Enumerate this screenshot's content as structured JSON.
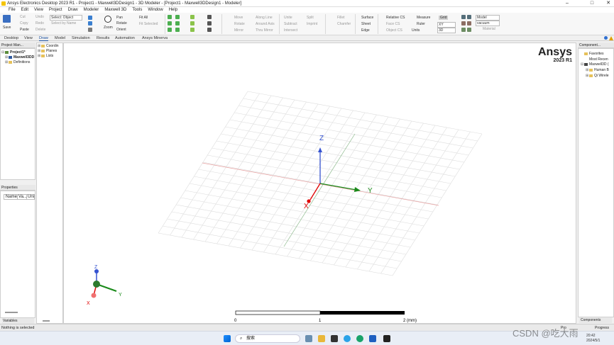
{
  "window": {
    "title": "Ansys Electronics Desktop 2023 R1 - Project1 - Maxwell3DDesign1 - 3D Modeler - [Project1 - Maxwell3DDesign1 - Modeler]",
    "controls": [
      "–",
      "□",
      "✕"
    ]
  },
  "menubar": {
    "items": [
      "File",
      "Edit",
      "View",
      "Project",
      "Draw",
      "Modeler",
      "Maxwell 3D",
      "Tools",
      "Window",
      "Help"
    ]
  },
  "ribbon": {
    "save": "Save",
    "cut": "Cut",
    "copy": "Copy",
    "paste": "Paste",
    "undo": "Undo",
    "redo": "Redo",
    "delete": "Delete",
    "select_value": "Select: Object",
    "select_by_name": "Select by Name",
    "pan": "Pan",
    "rotate": "Rotate",
    "orient": "Orient",
    "zoom": "Zoom",
    "fit_all": "Fit All",
    "fit_selected": "Fit Selected",
    "move": "Move",
    "rotate2": "Rotate",
    "mirror": "Mirror",
    "along_line": "Along Line",
    "around_axis": "Around Axis",
    "thru_mirror": "Thru Mirror",
    "unite": "Unite",
    "subtract": "Subtract",
    "intersect": "Intersect",
    "split": "Split",
    "imprint": "Imprint",
    "fillet": "Fillet",
    "chamfer": "Chamfer",
    "surface": "Surface",
    "sheet": "Sheet",
    "edge": "Edge",
    "relative_cs": "Relative CS",
    "face_cs": "Face CS",
    "object_cs": "Object CS",
    "measure": "Measure",
    "ruler": "Ruler",
    "units": "Units",
    "grid": "Grid",
    "plane_value": "XY",
    "dim_value": "3D",
    "model_value": "Model",
    "material_value": "vacuum",
    "material": "Material"
  },
  "tabs": [
    "Desktop",
    "View",
    "Draw",
    "Model",
    "Simulation",
    "Results",
    "Automation",
    "Ansys Minerva"
  ],
  "active_tab": "Draw",
  "project_manager": {
    "header": "Project Man...",
    "items": [
      {
        "label": "Project1*",
        "level": 0
      },
      {
        "label": "Maxwell3DD",
        "level": 1
      },
      {
        "label": "Definitions",
        "level": 1
      }
    ]
  },
  "model_tree": {
    "items": [
      "Coordin",
      "Planes",
      "Lists"
    ]
  },
  "properties": {
    "header": "Properties",
    "columns": [
      "Name",
      "Va...",
      "Uni"
    ]
  },
  "variables_tab": "Variables",
  "components": {
    "header": "Component...",
    "items": [
      "Favorites",
      "Most Recen",
      "Maxwell3D (",
      "Human B",
      "Qi Wirele"
    ],
    "footer_tab": "Components"
  },
  "viewport": {
    "brand": "Ansys",
    "version": "2023 R1",
    "axis_labels": [
      "Z",
      "Y",
      "X"
    ],
    "triad_labels": [
      "Z",
      "Y",
      "X"
    ],
    "scale_labels": [
      "0",
      "1",
      "2 (mm)"
    ]
  },
  "status": {
    "text": "Nothing is selected",
    "right_tabs": [
      "Pro",
      "Progress"
    ]
  },
  "taskbar": {
    "search": "搜索",
    "clock_time": "20:42",
    "clock_date": "2024/5/1"
  },
  "watermark": "CSDN @吃大雨"
}
